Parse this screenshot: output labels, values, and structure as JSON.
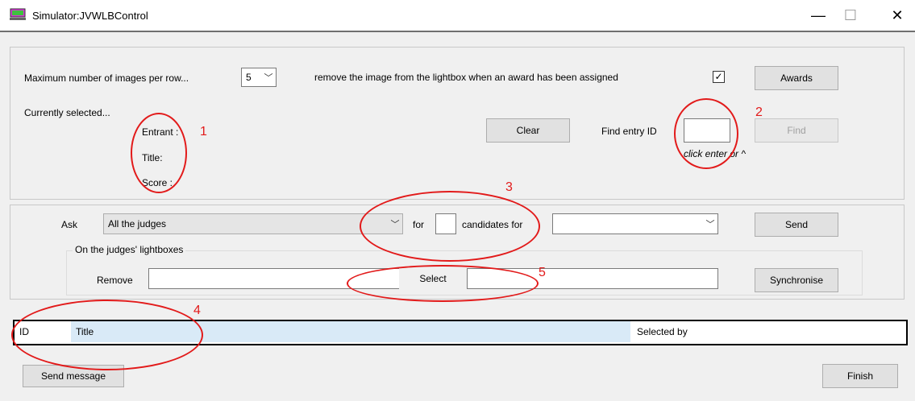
{
  "window": {
    "title": "Simulator:JVWLBControl",
    "minimize": "—",
    "maximize": "☐",
    "close": "✕"
  },
  "settings": {
    "max_images_label": "Maximum number of images per row...",
    "max_images_value": "5",
    "remove_label": "remove the image from the lightbox when an award has been assigned",
    "remove_checked": "✓",
    "awards_button": "Awards",
    "currently_selected_label": "Currently selected...",
    "entrant_label": "Entrant :",
    "title_label": "Title:",
    "score_label": "Score :",
    "clear_button": "Clear",
    "find_entry_label": "Find entry ID",
    "find_entry_value": "",
    "find_button": "Find",
    "find_hint": "click enter or ^"
  },
  "ask": {
    "ask_label": "Ask",
    "judges_value": "All the judges",
    "for_label": "for",
    "candidates_value": "",
    "candidates_label": "candidates for",
    "candidates_for_value": "",
    "send_button": "Send",
    "group_title": "On the judges' lightboxes",
    "remove_label": "Remove",
    "remove_value": "",
    "select_label": "Select",
    "select_value": "",
    "synchronise_button": "Synchronise"
  },
  "list": {
    "columns": [
      "ID",
      "Title",
      "Selected by"
    ]
  },
  "footer": {
    "send_message_button": "Send message",
    "finish_button": "Finish"
  },
  "annotations": [
    "1",
    "2",
    "3",
    "4",
    "5"
  ],
  "colors": {
    "annotation": "#e21a1a",
    "header_selected": "#d9eaf7"
  }
}
